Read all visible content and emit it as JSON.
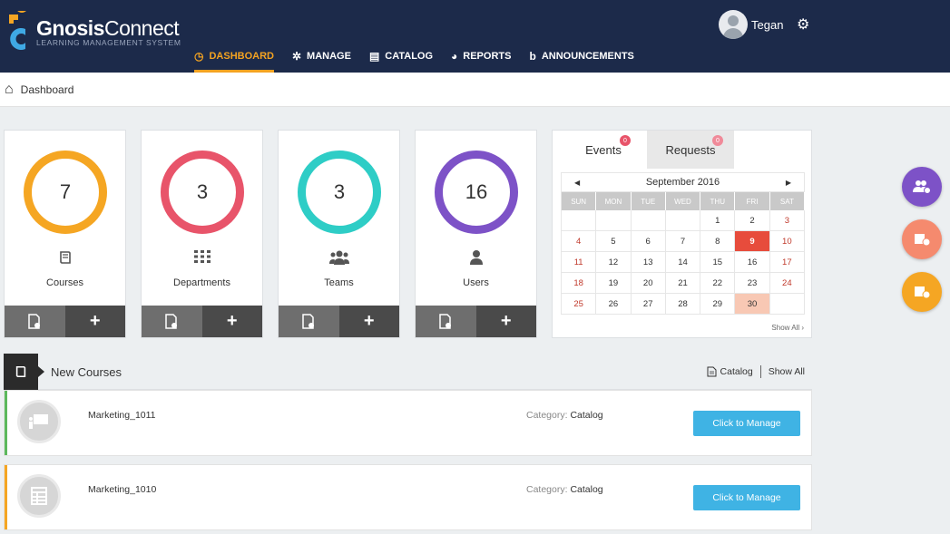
{
  "brand": {
    "name_bold": "Gnosis",
    "name_rest": "Connect",
    "tagline": "LEARNING MANAGEMENT SYSTEM"
  },
  "nav": [
    {
      "label": "DASHBOARD",
      "icon": "dashboard-icon",
      "active": true
    },
    {
      "label": "MANAGE",
      "icon": "manage-icon",
      "active": false
    },
    {
      "label": "CATALOG",
      "icon": "catalog-icon",
      "active": false
    },
    {
      "label": "REPORTS",
      "icon": "reports-icon",
      "active": false
    },
    {
      "label": "ANNOUNCEMENTS",
      "icon": "announcements-icon",
      "active": false
    }
  ],
  "user": {
    "name": "Tegan"
  },
  "breadcrumb": {
    "label": "Dashboard"
  },
  "stats": [
    {
      "value": "7",
      "label": "Courses",
      "color": "#f5a623"
    },
    {
      "value": "3",
      "label": "Departments",
      "color": "#e8546a"
    },
    {
      "value": "3",
      "label": "Teams",
      "color": "#2ecdc6"
    },
    {
      "value": "16",
      "label": "Users",
      "color": "#7d52c7"
    }
  ],
  "calendar": {
    "tabs": [
      {
        "label": "Events",
        "badge": "0"
      },
      {
        "label": "Requests",
        "badge": "0"
      }
    ],
    "month": "September 2016",
    "weekdays": [
      "SUN",
      "MON",
      "TUE",
      "WED",
      "THU",
      "FRI",
      "SAT"
    ],
    "today": "9",
    "selected": "30",
    "weeks": [
      [
        "",
        "",
        "",
        "",
        "1",
        "2",
        "3"
      ],
      [
        "4",
        "5",
        "6",
        "7",
        "8",
        "9",
        "10"
      ],
      [
        "11",
        "12",
        "13",
        "14",
        "15",
        "16",
        "17"
      ],
      [
        "18",
        "19",
        "20",
        "21",
        "22",
        "23",
        "24"
      ],
      [
        "25",
        "26",
        "27",
        "28",
        "29",
        "30",
        ""
      ]
    ],
    "show_all": "Show All ›"
  },
  "fabs": [
    {
      "icon": "users-add-icon",
      "color": "#7d52c7"
    },
    {
      "icon": "course-approval-icon",
      "color": "#f58a6e"
    },
    {
      "icon": "course-assign-icon",
      "color": "#f5a623"
    }
  ],
  "new_courses": {
    "title": "New Courses",
    "catalog_link": "Catalog",
    "show_all": "Show All",
    "category_label": "Category:",
    "manage_label": "Click to Manage",
    "items": [
      {
        "name": "Marketing_1011",
        "category": "Catalog",
        "accent": "#5cb85c"
      },
      {
        "name": "Marketing_1010",
        "category": "Catalog",
        "accent": "#f5a623"
      }
    ]
  }
}
